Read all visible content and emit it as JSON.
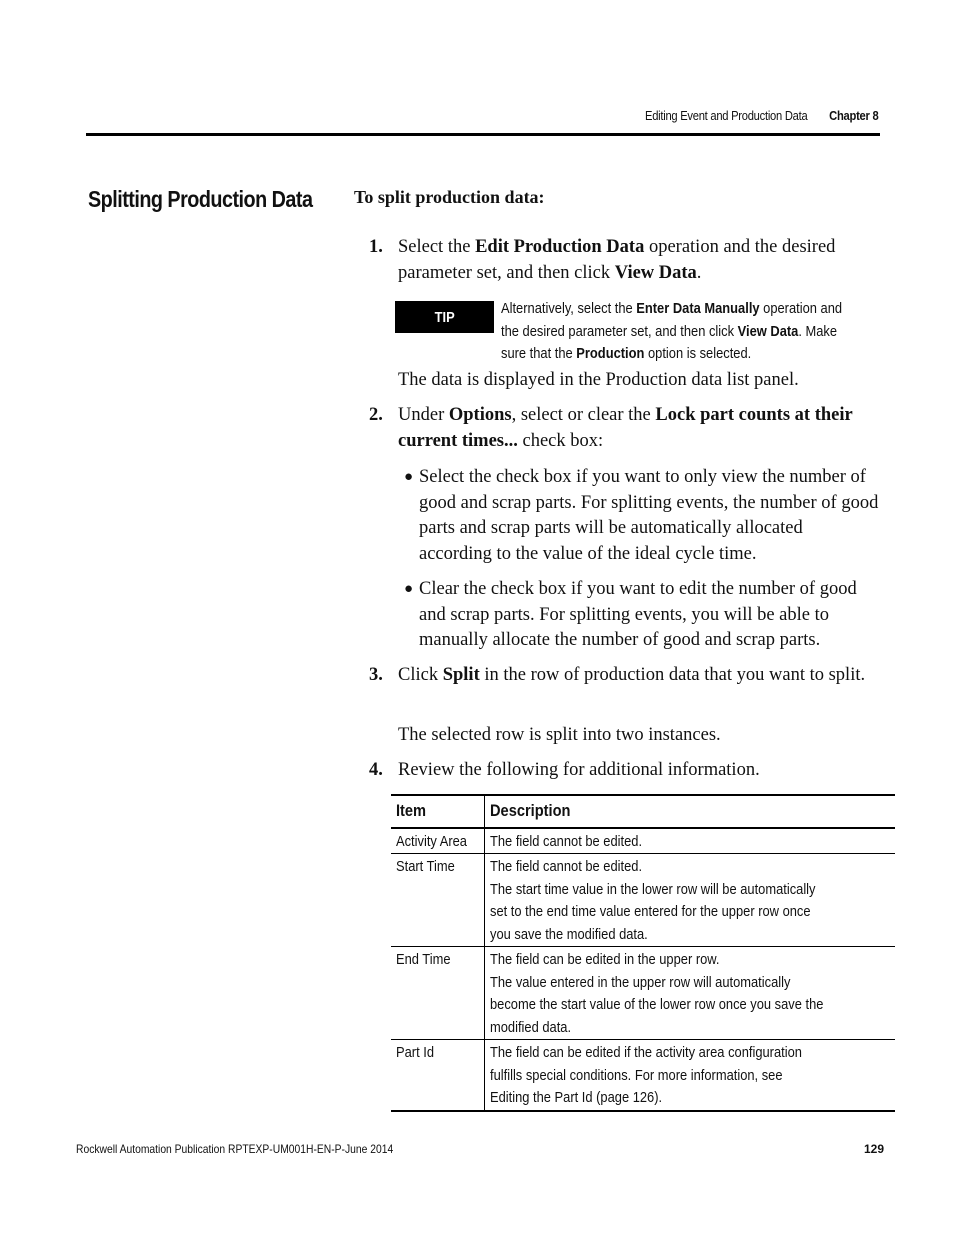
{
  "header": {
    "section": "Editing Event and Production Data",
    "chapter": "Chapter 8"
  },
  "section_title": "Splitting Production Data",
  "procedure_title": "To split production data:",
  "steps": [
    {
      "num": "1.",
      "parts": [
        "Select the ",
        "Edit Production Data",
        " operation and the desired parameter set, and then click ",
        "View Data",
        "."
      ]
    },
    {
      "num": "2.",
      "parts": [
        "Under ",
        "Options",
        ", select or clear the ",
        "Lock part counts at their current times...",
        " check box:"
      ]
    },
    {
      "num": "3.",
      "parts": [
        "Click ",
        "Split",
        " in the row of production data that you want to split."
      ]
    },
    {
      "num": "4.",
      "parts": [
        "Review the following for additional information."
      ]
    }
  ],
  "tip": {
    "label": "TIP",
    "parts": [
      "Alternatively, select the ",
      "Enter Data Manually",
      " operation and the desired parameter set, and then click ",
      "View Data",
      ". Make sure that the ",
      "Production",
      " option is selected."
    ]
  },
  "step1_result": "The data is displayed in the Production data list panel.",
  "step2_bullets": [
    "Select the check box if you want to only view the number of good and scrap parts. For splitting events, the number of good parts and scrap parts will be automatically allocated according to the value of the ideal cycle time.",
    "Clear the check box if you want to edit the number of good and scrap parts. For splitting events, you will be able to manually allocate the number of good and scrap parts."
  ],
  "step3_result": "The selected row is split into two instances.",
  "table": {
    "headers": [
      "Item",
      "Description"
    ],
    "rows": [
      {
        "item": "Activity Area",
        "lines": [
          "The field cannot be edited."
        ]
      },
      {
        "item": "Start Time",
        "lines": [
          "The field cannot be edited.",
          "The start time value in the lower row will be automatically",
          "set to the end time value entered for the upper row once",
          "you save the modified data."
        ]
      },
      {
        "item": "End Time",
        "lines": [
          "The field can be edited in the upper row.",
          "The value entered in the upper row will automatically",
          "become the start value of the lower row once you save the",
          "modified data."
        ]
      },
      {
        "item": "Part Id",
        "lines": [
          "The field can be edited if the activity area configuration",
          "fulfills special conditions. For more information, see",
          "Editing the Part Id (page 126)."
        ]
      }
    ]
  },
  "footer": {
    "publication": "Rockwell Automation Publication RPTEXP-UM001H-EN-P-June 2014",
    "page_number": "129"
  }
}
